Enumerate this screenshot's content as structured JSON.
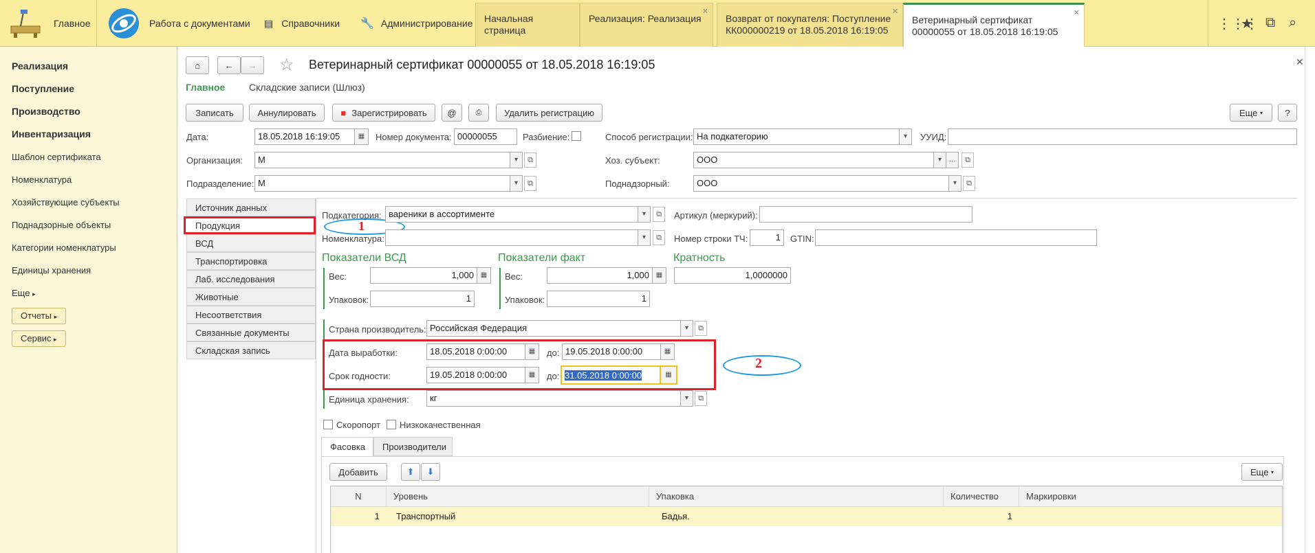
{
  "topbar": {
    "home_label": "Главное",
    "docs_label": "Работа с документами",
    "ref_label": "Справочники",
    "admin_label": "Администрирование",
    "tabs": [
      {
        "label": "Начальная страница"
      },
      {
        "label": "Реализация: Реализация"
      },
      {
        "label": "Возврат от покупателя: Поступление КК000000219 от 18.05.2018 16:19:05"
      },
      {
        "label": "Ветеринарный сертификат 00000055 от 18.05.2018 16:19:05"
      }
    ]
  },
  "sidebar": {
    "items": [
      "Реализация",
      "Поступление",
      "Производство",
      "Инвентаризация",
      "Шаблон сертификата",
      "Номенклатура",
      "Хозяйствующие субъекты",
      "Поднадзорные объекты",
      "Категории номенклатуры",
      "Единицы хранения",
      "Еще"
    ],
    "reports_label": "Отчеты",
    "service_label": "Сервис"
  },
  "form": {
    "title": "Ветеринарный сертификат 00000055 от 18.05.2018 16:19:05",
    "subnav_main": "Главное",
    "subnav_store": "Складские записи (Шлюз)",
    "toolbar": {
      "write": "Записать",
      "cancel": "Аннулировать",
      "register": "Зарегистрировать",
      "delete_reg": "Удалить регистрацию",
      "more": "Еще",
      "help": "?"
    },
    "date_label": "Дата:",
    "date_value": "18.05.2018 16:19:05",
    "docnum_label": "Номер документа:",
    "docnum_value": "00000055",
    "split_label": "Разбиение:",
    "regmethod_label": "Способ регистрации:",
    "regmethod_value": "На подкатегорию",
    "uuid_label": "УУИД:",
    "org_label": "Организация:",
    "org_value": "М",
    "entity_label": "Хоз. субъект:",
    "entity_value": "ООО",
    "dept_label": "Подразделение:",
    "dept_value": "М",
    "supervised_label": "Поднадзорный:",
    "supervised_value": "ООО"
  },
  "sidetabs": [
    "Источник данных",
    "Продукция",
    "ВСД",
    "Транспортировка",
    "Лаб. исследования",
    "Животные",
    "Несоответствия",
    "Связанные документы",
    "Складская запись"
  ],
  "product": {
    "subcat_label": "Подкатегория:",
    "subcat_value": "вареники в ассортименте",
    "article_label": "Артикул (меркурий):",
    "nomen_label": "Номенклатура:",
    "rownum_label": "Номер строки ТЧ:",
    "rownum_value": "1",
    "gtin_label": "GTIN:",
    "vsd_title": "Показатели ВСД",
    "fact_title": "Показатели факт",
    "mult_title": "Кратность",
    "weight_label": "Вес:",
    "vsd_weight": "1,000",
    "fact_weight": "1,000",
    "mult_value": "1,0000000",
    "packs_label": "Упаковок:",
    "vsd_packs": "1",
    "fact_packs": "1",
    "country_label": "Страна производитель:",
    "country_value": "Российская Федерация",
    "prod_date_label": "Дата выработки:",
    "prod_date_from": "18.05.2018  0:00:00",
    "to_label": "до:",
    "prod_date_to": "19.05.2018  0:00:00",
    "expiry_label": "Срок годности:",
    "expiry_from": "19.05.2018  0:00:00",
    "expiry_to": "31.05.2018  0:00:00",
    "unit_label": "Единица хранения:",
    "unit_value": "кг",
    "perishable_label": "Скоропорт",
    "lowquality_label": "Низкокачественная"
  },
  "packing": {
    "tab_packing": "Фасовка",
    "tab_producers": "Производители",
    "add_label": "Добавить",
    "more_label": "Еще",
    "columns": [
      "N",
      "Уровень",
      "Упаковка",
      "Количество",
      "Маркировки"
    ],
    "rows": [
      {
        "n": "1",
        "level": "Транспортный",
        "pack": "Бадья.",
        "qty": "1",
        "marks": ""
      }
    ]
  },
  "annotations": {
    "one": "1",
    "two": "2"
  },
  "colors": {
    "accent_green": "#3c9a4c",
    "topbar_yellow": "#fbed9e",
    "annotation_red": "#e0202a",
    "annotation_blue": "#1e9be0",
    "selection_blue": "#3169c6"
  }
}
